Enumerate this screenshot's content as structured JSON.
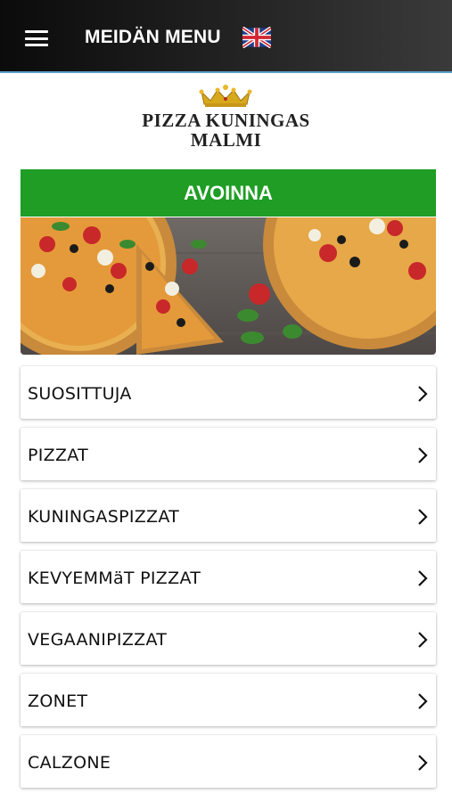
{
  "header": {
    "title": "MEIDÄN MENU",
    "menu_icon": "hamburger-icon",
    "language_icon": "uk-flag-icon",
    "background": "#111111"
  },
  "logo": {
    "line1": "PIZZA KUNINGAS",
    "line2": "MALMI",
    "icon": "crown-icon"
  },
  "status": {
    "label": "AVOINNA",
    "color": "#1f9d25"
  },
  "hero": {
    "icon": "pizza-image"
  },
  "categories": [
    {
      "label": "SUOSITTUJA"
    },
    {
      "label": "PIZZAT"
    },
    {
      "label": "KUNINGASPIZZAT"
    },
    {
      "label": "KEVYEMMäT PIZZAT"
    },
    {
      "label": "VEGAANIPIZZAT"
    },
    {
      "label": "ZONET"
    },
    {
      "label": "CALZONE"
    }
  ]
}
